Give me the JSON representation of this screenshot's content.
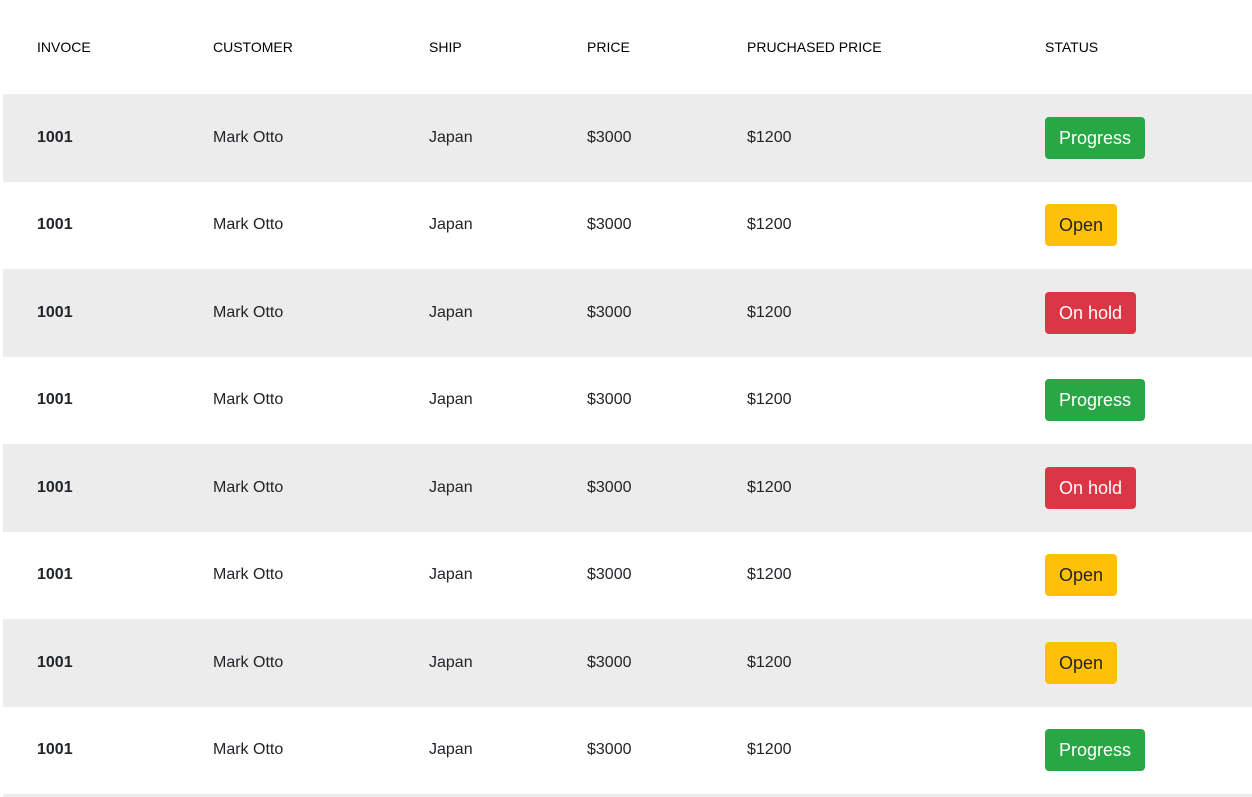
{
  "table": {
    "headers": [
      "INVOCE",
      "CUSTOMER",
      "SHIP",
      "PRICE",
      "PRUCHASED PRICE",
      "STATUS"
    ],
    "rows": [
      {
        "invoice": "1001",
        "customer": "Mark Otto",
        "ship": "Japan",
        "price": "$3000",
        "purchased_price": "$1200",
        "status": "Progress",
        "status_kind": "progress"
      },
      {
        "invoice": "1001",
        "customer": "Mark Otto",
        "ship": "Japan",
        "price": "$3000",
        "purchased_price": "$1200",
        "status": "Open",
        "status_kind": "open"
      },
      {
        "invoice": "1001",
        "customer": "Mark Otto",
        "ship": "Japan",
        "price": "$3000",
        "purchased_price": "$1200",
        "status": "On hold",
        "status_kind": "hold"
      },
      {
        "invoice": "1001",
        "customer": "Mark Otto",
        "ship": "Japan",
        "price": "$3000",
        "purchased_price": "$1200",
        "status": "Progress",
        "status_kind": "progress"
      },
      {
        "invoice": "1001",
        "customer": "Mark Otto",
        "ship": "Japan",
        "price": "$3000",
        "purchased_price": "$1200",
        "status": "On hold",
        "status_kind": "hold"
      },
      {
        "invoice": "1001",
        "customer": "Mark Otto",
        "ship": "Japan",
        "price": "$3000",
        "purchased_price": "$1200",
        "status": "Open",
        "status_kind": "open"
      },
      {
        "invoice": "1001",
        "customer": "Mark Otto",
        "ship": "Japan",
        "price": "$3000",
        "purchased_price": "$1200",
        "status": "Open",
        "status_kind": "open"
      },
      {
        "invoice": "1001",
        "customer": "Mark Otto",
        "ship": "Japan",
        "price": "$3000",
        "purchased_price": "$1200",
        "status": "Progress",
        "status_kind": "progress"
      }
    ]
  },
  "colors": {
    "progress": "#28a745",
    "open": "#ffc107",
    "hold": "#dc3545",
    "stripe": "#ececec"
  }
}
